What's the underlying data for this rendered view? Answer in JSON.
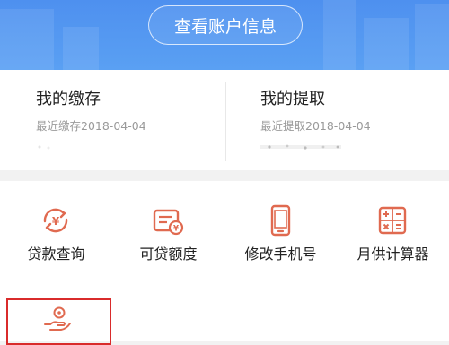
{
  "header": {
    "account_button_label": "查看账户信息"
  },
  "deposit": {
    "title": "我的缴存",
    "recent": "最近缴存2018-04-04"
  },
  "withdraw": {
    "title": "我的提取",
    "recent": "最近提取2018-04-04"
  },
  "services": [
    {
      "label": "贷款查询",
      "icon": "loan-query-icon"
    },
    {
      "label": "可贷额度",
      "icon": "loan-quota-icon"
    },
    {
      "label": "修改手机号",
      "icon": "phone-icon"
    },
    {
      "label": "月供计算器",
      "icon": "calculator-icon"
    }
  ],
  "extra_service": {
    "icon": "hand-coin-icon"
  },
  "colors": {
    "banner": "#5aa0f3",
    "icon_accent": "#e06a50",
    "highlight_border": "#d92b2b"
  }
}
